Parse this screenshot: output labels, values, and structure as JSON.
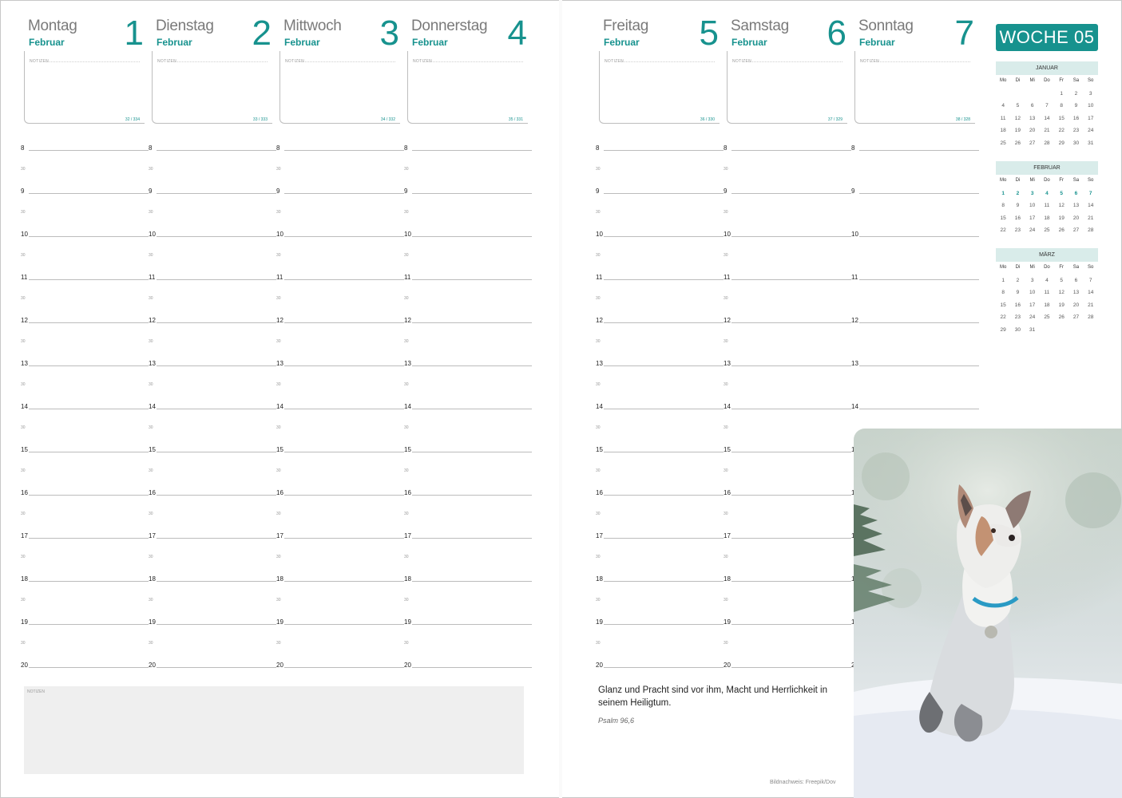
{
  "labels": {
    "notes": "NOTIZEN"
  },
  "days": [
    {
      "name": "Montag",
      "month": "Februar",
      "num": "1",
      "count": "32 / 334",
      "hours": [
        "8",
        "30",
        "9",
        "30",
        "10",
        "30",
        "11",
        "30",
        "12",
        "30",
        "13",
        "30",
        "14",
        "30",
        "15",
        "30",
        "16",
        "30",
        "17",
        "30",
        "18",
        "30",
        "19",
        "30",
        "20"
      ]
    },
    {
      "name": "Dienstag",
      "month": "Februar",
      "num": "2",
      "count": "33 / 333",
      "hours": [
        "8",
        "30",
        "9",
        "30",
        "10",
        "30",
        "11",
        "30",
        "12",
        "30",
        "13",
        "30",
        "14",
        "30",
        "15",
        "30",
        "16",
        "30",
        "17",
        "30",
        "18",
        "30",
        "19",
        "30",
        "20"
      ]
    },
    {
      "name": "Mittwoch",
      "month": "Februar",
      "num": "3",
      "count": "34 / 332",
      "hours": [
        "8",
        "30",
        "9",
        "30",
        "10",
        "30",
        "11",
        "30",
        "12",
        "30",
        "13",
        "30",
        "14",
        "30",
        "15",
        "30",
        "16",
        "30",
        "17",
        "30",
        "18",
        "30",
        "19",
        "30",
        "20"
      ]
    },
    {
      "name": "Donnerstag",
      "month": "Februar",
      "num": "4",
      "count": "35 / 331",
      "hours": [
        "8",
        "30",
        "9",
        "30",
        "10",
        "30",
        "11",
        "30",
        "12",
        "30",
        "13",
        "30",
        "14",
        "30",
        "15",
        "30",
        "16",
        "30",
        "17",
        "30",
        "18",
        "30",
        "19",
        "30",
        "20"
      ]
    },
    {
      "name": "Freitag",
      "month": "Februar",
      "num": "5",
      "count": "36 / 330",
      "hours": [
        "8",
        "30",
        "9",
        "30",
        "10",
        "30",
        "11",
        "30",
        "12",
        "30",
        "13",
        "30",
        "14",
        "30",
        "15",
        "30",
        "16",
        "30",
        "17",
        "30",
        "18",
        "30",
        "19",
        "30",
        "20"
      ]
    },
    {
      "name": "Samstag",
      "month": "Februar",
      "num": "6",
      "count": "37 / 329",
      "hours": [
        "8",
        "30",
        "9",
        "30",
        "10",
        "30",
        "11",
        "30",
        "12",
        "30",
        "13",
        "30",
        "14",
        "30",
        "15",
        "30",
        "16",
        "30",
        "17",
        "30",
        "18",
        "30",
        "19",
        "30",
        "20"
      ]
    },
    {
      "name": "Sonntag",
      "month": "Februar",
      "num": "7",
      "count": "38 / 328",
      "hours": [
        "8",
        "9",
        "10",
        "11",
        "12",
        "13",
        "14",
        "15",
        "16",
        "17",
        "18",
        "19",
        "20"
      ]
    }
  ],
  "week": {
    "label": "WOCHE 05"
  },
  "dow": [
    "Mo",
    "Di",
    "Mi",
    "Do",
    "Fr",
    "Sa",
    "So"
  ],
  "calendars": [
    {
      "month": "JANUAR",
      "weeks": [
        [
          "",
          "",
          "",
          "",
          "1",
          "2",
          "3"
        ],
        [
          "4",
          "5",
          "6",
          "7",
          "8",
          "9",
          "10"
        ],
        [
          "11",
          "12",
          "13",
          "14",
          "15",
          "16",
          "17"
        ],
        [
          "18",
          "19",
          "20",
          "21",
          "22",
          "23",
          "24"
        ],
        [
          "25",
          "26",
          "27",
          "28",
          "29",
          "30",
          "31"
        ]
      ]
    },
    {
      "month": "FEBRUAR",
      "weeks": [
        [
          "1",
          "2",
          "3",
          "4",
          "5",
          "6",
          "7"
        ],
        [
          "8",
          "9",
          "10",
          "11",
          "12",
          "13",
          "14"
        ],
        [
          "15",
          "16",
          "17",
          "18",
          "19",
          "20",
          "21"
        ],
        [
          "22",
          "23",
          "24",
          "25",
          "26",
          "27",
          "28"
        ]
      ]
    },
    {
      "month": "MÄRZ",
      "weeks": [
        [
          "1",
          "2",
          "3",
          "4",
          "5",
          "6",
          "7"
        ],
        [
          "8",
          "9",
          "10",
          "11",
          "12",
          "13",
          "14"
        ],
        [
          "15",
          "16",
          "17",
          "18",
          "19",
          "20",
          "21"
        ],
        [
          "22",
          "23",
          "24",
          "25",
          "26",
          "27",
          "28"
        ],
        [
          "29",
          "30",
          "31",
          "",
          "",
          "",
          ""
        ]
      ]
    }
  ],
  "quote": {
    "text": "Glanz und Pracht sind vor ihm, Macht und Herrlichkeit in seinem Heiligtum.",
    "ref": "Psalm 96,6"
  },
  "credit": "Bildnachweis: Freepik/Dov",
  "colors": {
    "accent": "#17928e",
    "calendar_header": "#d9ecea",
    "notes_panel": "#efefef"
  }
}
